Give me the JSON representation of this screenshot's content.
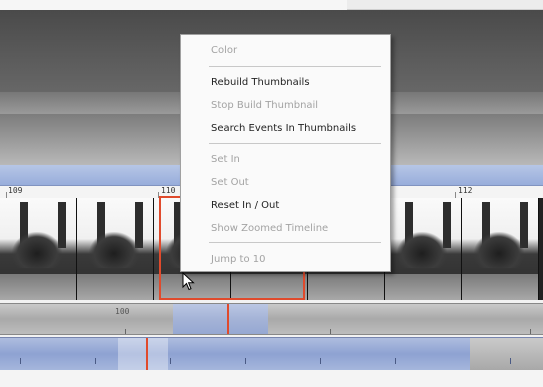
{
  "context_menu": {
    "items": [
      {
        "label": "Color",
        "enabled": false
      },
      {
        "label": "Rebuild Thumbnails",
        "enabled": true
      },
      {
        "label": "Stop Build Thumbnail",
        "enabled": false
      },
      {
        "label": "Search Events In Thumbnails",
        "enabled": true
      },
      {
        "label": "Set In",
        "enabled": false
      },
      {
        "label": "Set Out",
        "enabled": false
      },
      {
        "label": "Reset In / Out",
        "enabled": true
      },
      {
        "label": "Show Zoomed Timeline",
        "enabled": false
      },
      {
        "label": "Jump to 10",
        "enabled": false
      }
    ]
  },
  "ruler": {
    "labels": [
      "109",
      "110",
      "112"
    ]
  },
  "overview_track": {
    "label": "100"
  },
  "colors": {
    "selection": "#e04a2c",
    "timeline_blue": "#98addb"
  }
}
